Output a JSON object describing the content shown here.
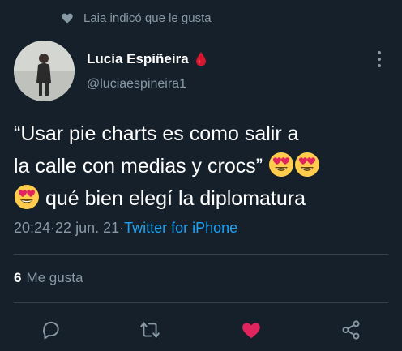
{
  "social_context": {
    "icon": "heart-icon",
    "text": "Laia indicó que le gusta"
  },
  "author": {
    "display_name": "Lucía Espiñeira",
    "name_emoji": "blood-drop-icon",
    "handle": "@luciaespineira1"
  },
  "tweet": {
    "line1": "“Usar pie charts es como salir a",
    "line2": "la calle con medias y crocs” ",
    "line3": " qué bien elegí la diplomatura",
    "emoji": "heart-eyes-emoji"
  },
  "meta": {
    "time": "20:24",
    "separator": " · ",
    "date": "22 jun. 21",
    "source": "Twitter for iPhone"
  },
  "stats": {
    "likes_count": "6",
    "likes_label": "Me gusta"
  },
  "actions": [
    "reply-icon",
    "retweet-icon",
    "like-icon",
    "share-icon"
  ],
  "colors": {
    "background": "#15202b",
    "muted": "#8899a6",
    "link": "#1da1f2",
    "like": "#e0245e"
  }
}
